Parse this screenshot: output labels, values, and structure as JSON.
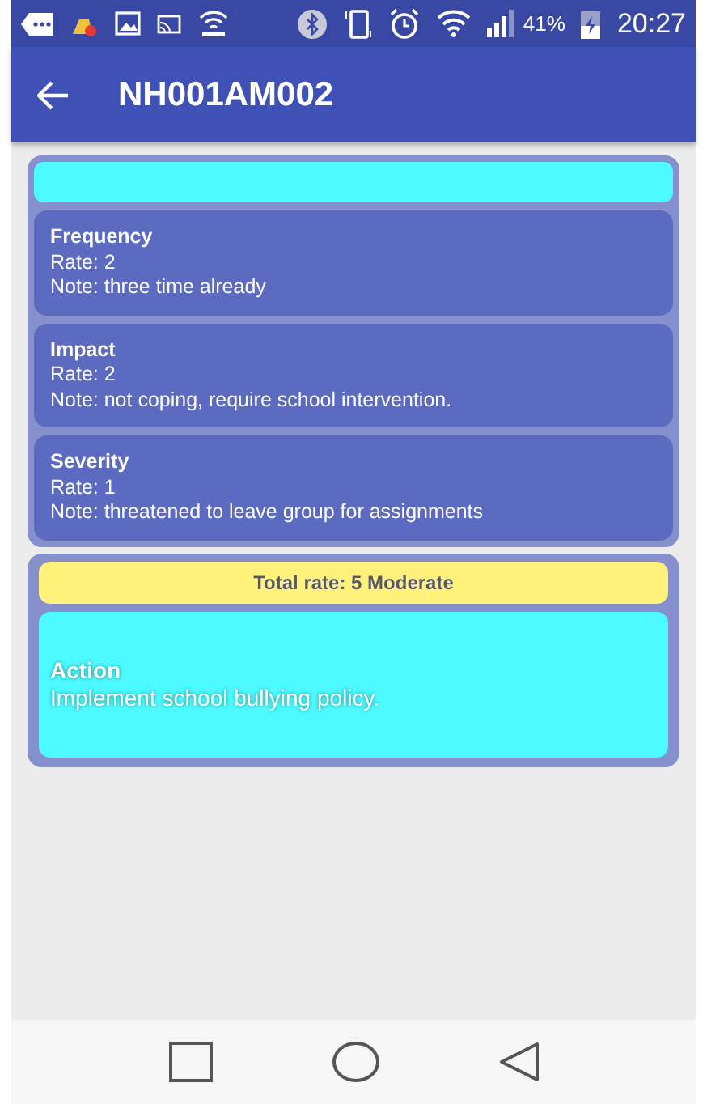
{
  "status_bar": {
    "battery": "41%",
    "time": "20:27"
  },
  "app_bar": {
    "title": "NH001AM002"
  },
  "assessment": {
    "items": [
      {
        "title": "Frequency",
        "rate": "Rate: 2",
        "note": "Note: three time already"
      },
      {
        "title": "Impact",
        "rate": "Rate: 2",
        "note": "Note: not coping, require school intervention."
      },
      {
        "title": "Severity",
        "rate": "Rate: 1",
        "note": "Note: threatened to leave group for assignments"
      }
    ]
  },
  "result": {
    "total": "Total rate: 5 Moderate",
    "action_title": "Action",
    "action_text": "Implement school bullying policy."
  }
}
